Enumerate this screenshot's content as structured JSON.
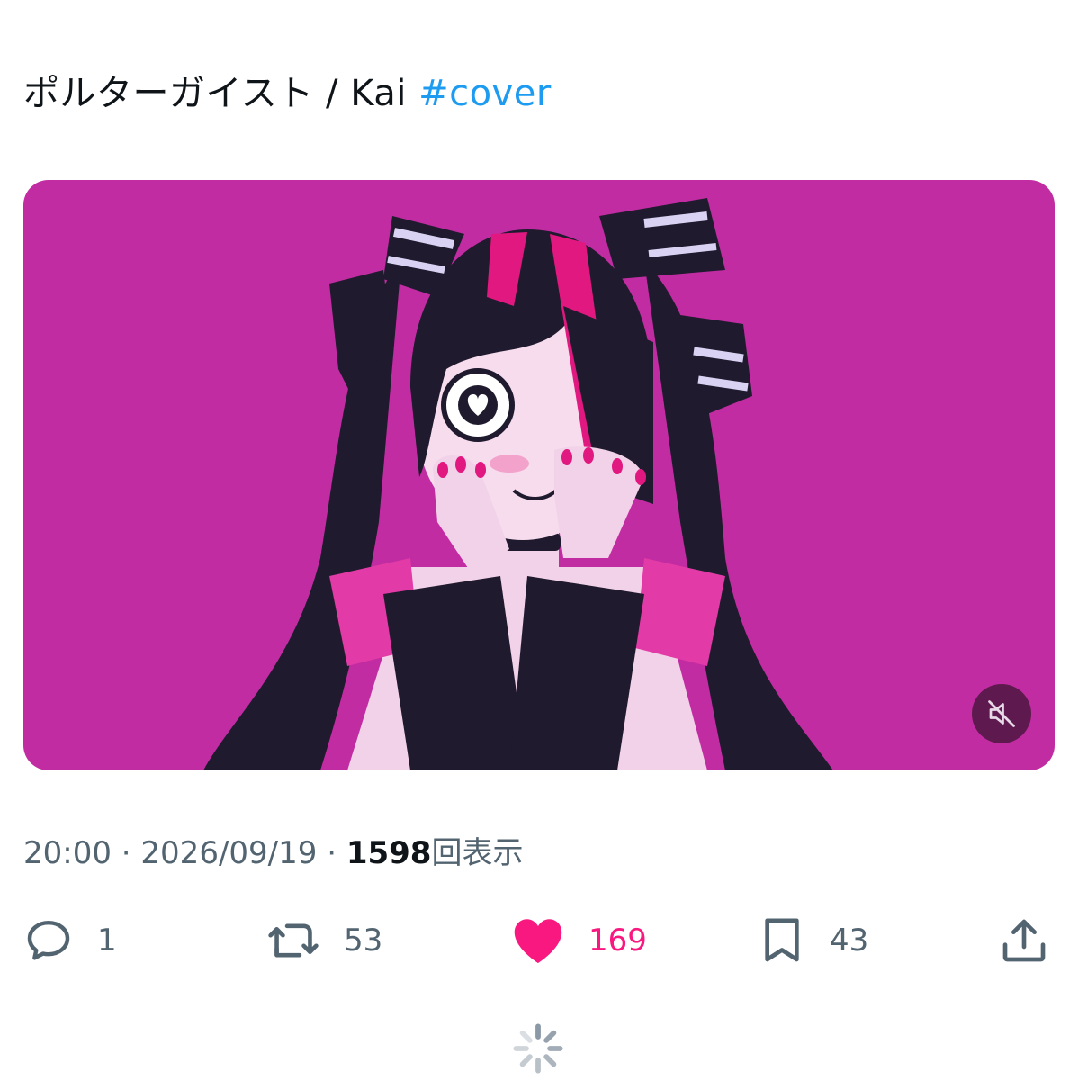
{
  "tweet": {
    "text": "ポルターガイスト / Kai ",
    "hashtag": "#cover",
    "time": "20:00",
    "separator": " · ",
    "date": "2026/09/19",
    "views_count": "1598",
    "views_label": "回表示"
  },
  "media": {
    "background_color": "#c22ca2",
    "mute_icon": "mute-speaker-icon"
  },
  "actions": {
    "replies": "1",
    "retweets": "53",
    "likes": "169",
    "bookmarks": "43"
  },
  "colors": {
    "hashtag": "#1d9bf0",
    "like": "#f91880",
    "muted_text": "#536471"
  },
  "loading_icon": "loading-spinner-icon"
}
